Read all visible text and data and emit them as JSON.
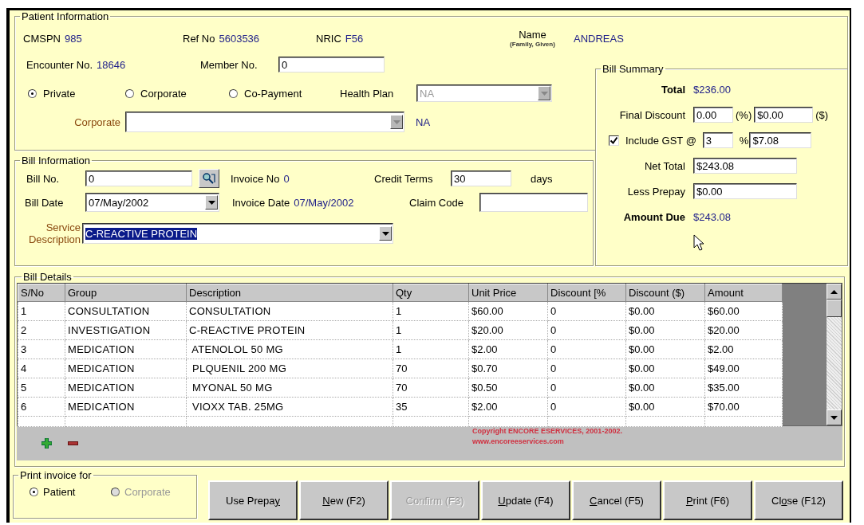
{
  "patient_information": {
    "title": "Patient Information",
    "cmspn": {
      "label": "CMSPN",
      "value": "985"
    },
    "ref_no": {
      "label": "Ref No",
      "value": "5603536"
    },
    "nric": {
      "label": "NRIC",
      "value": "F56"
    },
    "name": {
      "label": "Name",
      "hint": "(Family, Given)",
      "value": "ANDREAS"
    },
    "encounter_no": {
      "label": "Encounter No.",
      "value": "18646"
    },
    "member_no": {
      "label": "Member No.",
      "value": "0"
    },
    "payment_types": [
      {
        "label": "Private",
        "selected": true
      },
      {
        "label": "Corporate",
        "selected": false
      },
      {
        "label": "Co-Payment",
        "selected": false
      }
    ],
    "health_plan": {
      "label": "Health Plan",
      "value": "NA",
      "disabled": true
    },
    "corporate": {
      "label": "Corporate",
      "disabled": true,
      "note": "NA"
    }
  },
  "bill_information": {
    "title": "Bill Information",
    "bill_no": {
      "label": "Bill No.",
      "value": "0"
    },
    "invoice_no": {
      "label": "Invoice No",
      "value": "0"
    },
    "credit_terms": {
      "label": "Credit Terms",
      "value": "30",
      "unit": "days"
    },
    "bill_date": {
      "label": "Bill Date",
      "value": "07/May/2002"
    },
    "invoice_date": {
      "label": "Invoice Date",
      "value": "07/May/2002"
    },
    "claim_code": {
      "label": "Claim Code"
    },
    "service_description": {
      "label": "Service Description",
      "value": "C-REACTIVE PROTEIN",
      "highlighted": true
    }
  },
  "bill_summary": {
    "title": "Bill Summary",
    "total": {
      "label": "Total",
      "value": "$236.00"
    },
    "final_discount": {
      "label": "Final Discount",
      "percent": "0.00",
      "percent_unit": "(%)",
      "amount": "$0.00",
      "amount_unit": "($)"
    },
    "gst": {
      "label": "Include GST @",
      "checked": true,
      "rate": "3",
      "rate_unit": "%",
      "amount": "$7.08"
    },
    "net_total": {
      "label": "Net Total",
      "value": "$243.08"
    },
    "less_prepay": {
      "label": "Less Prepay",
      "value": "$0.00"
    },
    "amount_due": {
      "label": "Amount Due",
      "value": "$243.08"
    }
  },
  "bill_details": {
    "title": "Bill Details",
    "columns": [
      "S/No",
      "Group",
      "Description",
      "Qty",
      "Unit Price",
      "Discount [%",
      "Discount ($)",
      "Amount"
    ],
    "rows": [
      [
        "1",
        "CONSULTATION",
        "CONSULTATION",
        "1",
        "$60.00",
        "0",
        "$0.00",
        "$60.00"
      ],
      [
        "2",
        "INVESTIGATION",
        "C-REACTIVE PROTEIN",
        "1",
        "$20.00",
        "0",
        "$0.00",
        "$20.00"
      ],
      [
        "3",
        "MEDICATION",
        " ATENOLOL 50 MG",
        "1",
        "$2.00",
        "0",
        "$0.00",
        "$2.00"
      ],
      [
        "4",
        "MEDICATION",
        " PLQUENIL 200 MG",
        "70",
        "$0.70",
        "0",
        "$0.00",
        "$49.00"
      ],
      [
        "5",
        "MEDICATION",
        " MYONAL 50 MG",
        "70",
        "$0.50",
        "0",
        "$0.00",
        "$35.00"
      ],
      [
        "6",
        "MEDICATION",
        " VIOXX TAB. 25MG",
        "35",
        "$2.00",
        "0",
        "$0.00",
        "$70.00"
      ]
    ],
    "copyright": "Copyright ENCORE ESERVICES, 2001-2002.",
    "website": "www.encoreeservices.com"
  },
  "print_invoice_for": {
    "title": "Print invoice for",
    "options": [
      {
        "label": "Patient",
        "selected": true,
        "disabled": false
      },
      {
        "label": "Corporate",
        "selected": false,
        "disabled": true
      }
    ]
  },
  "buttons": [
    {
      "label_runs": [
        {
          "text": "Use Prepa",
          "underlined": false
        },
        {
          "text": "y",
          "underlined": true
        }
      ],
      "disabled": false
    },
    {
      "label_runs": [
        {
          "text": "N",
          "underlined": true
        },
        {
          "text": "ew (F2)",
          "underlined": false
        }
      ],
      "disabled": false
    },
    {
      "label_runs": [
        {
          "text": "Confirm (F3)",
          "underlined": false
        }
      ],
      "disabled": true
    },
    {
      "label_runs": [
        {
          "text": "U",
          "underlined": true
        },
        {
          "text": "pdate (F4)",
          "underlined": false
        }
      ],
      "disabled": false
    },
    {
      "label_runs": [
        {
          "text": "C",
          "underlined": true
        },
        {
          "text": "ancel (F5)",
          "underlined": false
        }
      ],
      "disabled": false
    },
    {
      "label_runs": [
        {
          "text": "P",
          "underlined": true
        },
        {
          "text": "rint (F6)",
          "underlined": false
        }
      ],
      "disabled": false
    },
    {
      "label_runs": [
        {
          "text": "Cl",
          "underlined": false
        },
        {
          "text": "o",
          "underlined": true
        },
        {
          "text": "se (F12)",
          "underlined": false
        }
      ],
      "disabled": false
    }
  ]
}
